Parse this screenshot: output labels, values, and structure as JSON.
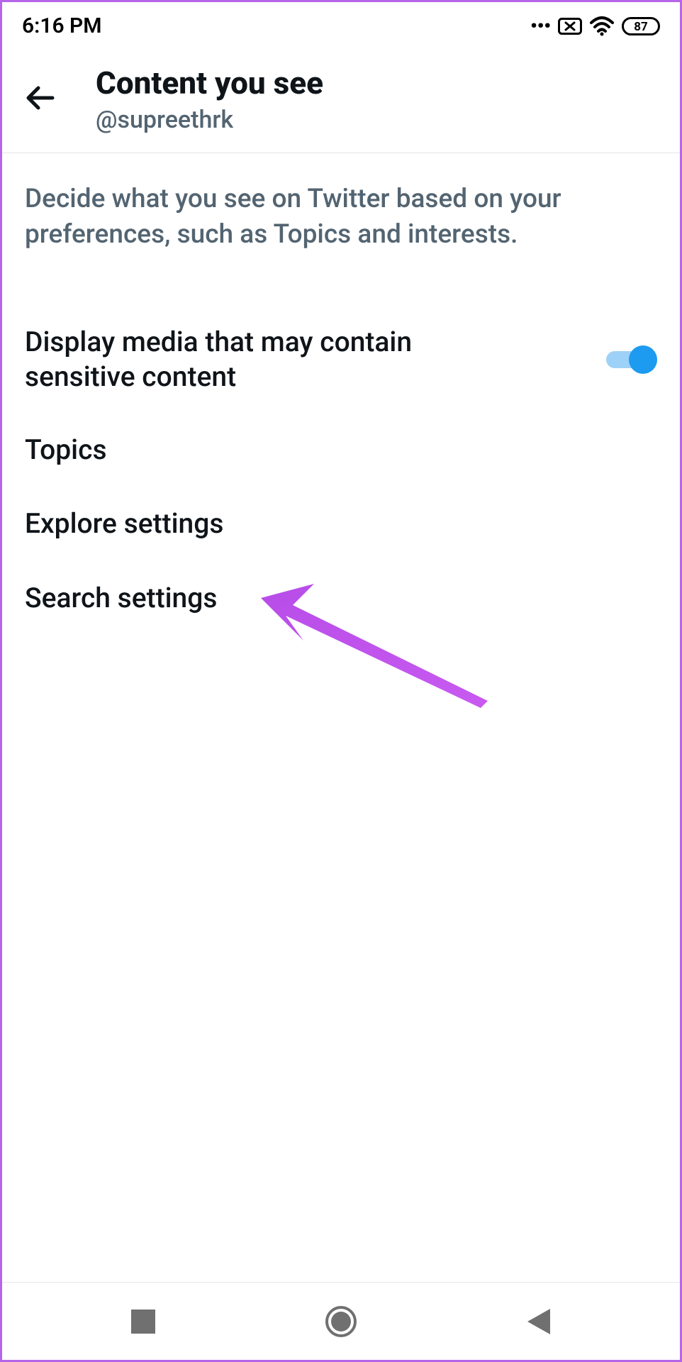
{
  "status_bar": {
    "time": "6:16 PM",
    "battery": "87"
  },
  "header": {
    "title": "Content you see",
    "subtitle": "@supreethrk"
  },
  "description": "Decide what you see on Twitter based on your preferences, such as Topics and interests.",
  "settings": {
    "sensitive_media": {
      "label": "Display media that may contain sensitive content",
      "enabled": true
    },
    "topics": {
      "label": "Topics"
    },
    "explore": {
      "label": "Explore settings"
    },
    "search": {
      "label": "Search settings"
    }
  }
}
